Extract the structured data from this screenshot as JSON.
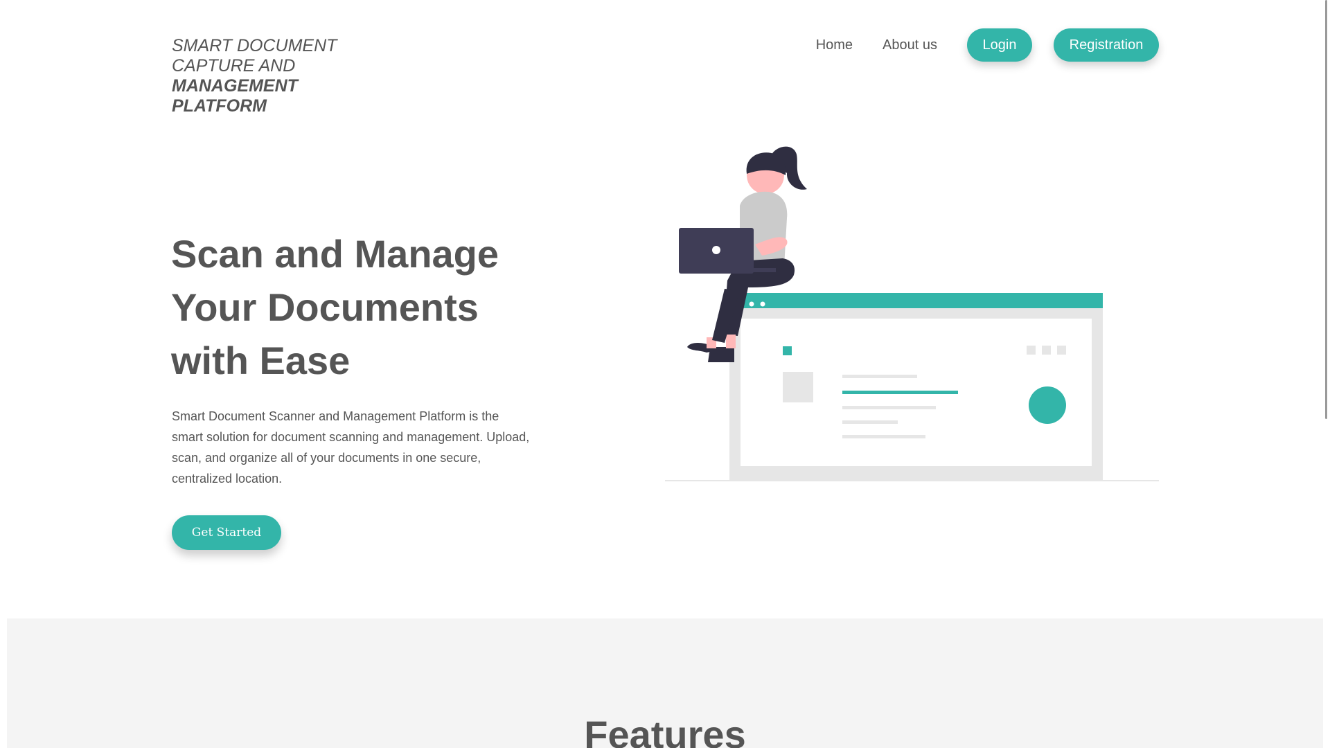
{
  "brand": {
    "line1": "SMART DOCUMENT",
    "line2": "CAPTURE AND",
    "line3": "MANAGEMENT",
    "line4": "PLATFORM"
  },
  "nav": {
    "home": "Home",
    "about": "About us",
    "login": "Login",
    "registration": "Registration"
  },
  "hero": {
    "title_line1": "Scan and Manage",
    "title_line2": "Your Documents",
    "title_line3": "with Ease",
    "description": "Smart Document Scanner and Management Platform is the smart solution for document scanning and management. Upload, scan, and organize all of your documents in one secure, centralized location.",
    "cta": "Get Started"
  },
  "features": {
    "title": "Features"
  },
  "colors": {
    "accent": "#33b5a9",
    "text": "#555555",
    "section_bg": "#f4f4f4",
    "laptop": "#3f3d56",
    "skin": "#ffb8b8"
  },
  "icons": {
    "illustration": "woman-with-laptop-sitting-on-browser-window-illustration"
  }
}
